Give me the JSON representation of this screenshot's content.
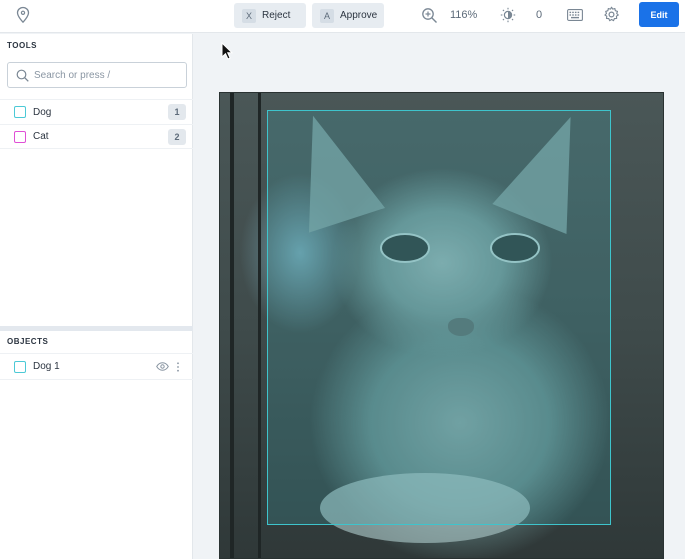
{
  "toolbar": {
    "reject_key": "X",
    "reject_label": "Reject",
    "approve_key": "A",
    "approve_label": "Approve",
    "zoom_value": "116%",
    "brightness_value": "0",
    "edit_label": "Edit"
  },
  "sidebar": {
    "tools_title": "TOOLS",
    "search_placeholder": "Search or press /",
    "tools": [
      {
        "label": "Dog",
        "hotkey": "1",
        "color": "#4cc9d6"
      },
      {
        "label": "Cat",
        "hotkey": "2",
        "color": "#e04fd6"
      }
    ],
    "objects_title": "OBJECTS",
    "objects": [
      {
        "label": "Dog 1",
        "color": "#4cc9d6"
      }
    ]
  },
  "colors": {
    "accent": "#1a72e8",
    "bbox": "#3ec4cc"
  }
}
